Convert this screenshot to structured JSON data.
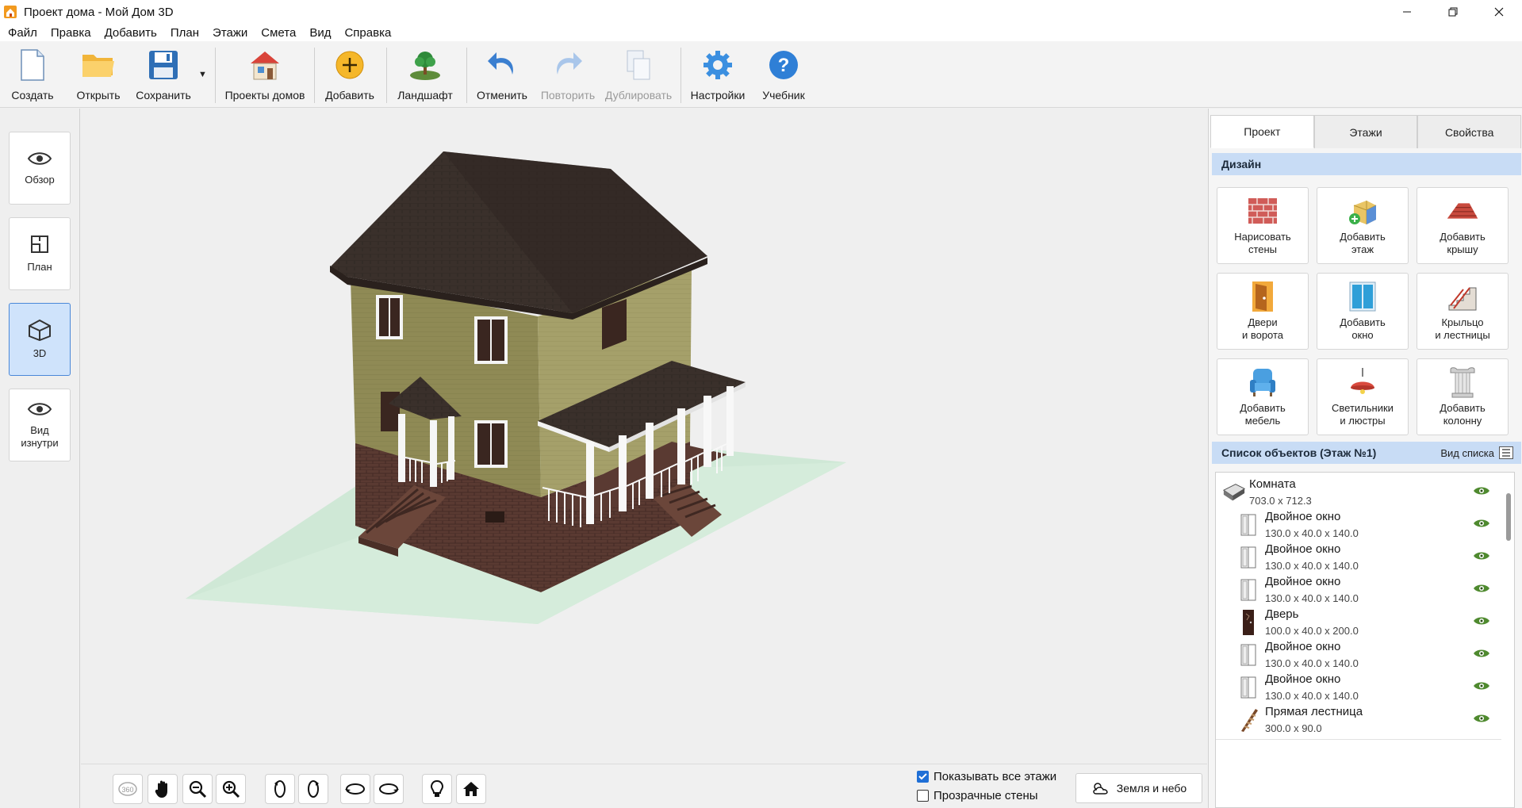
{
  "window": {
    "title": "Проект дома - Мой Дом 3D"
  },
  "menu": [
    "Файл",
    "Правка",
    "Добавить",
    "План",
    "Этажи",
    "Смета",
    "Вид",
    "Справка"
  ],
  "toolbar": {
    "create": "Создать",
    "open": "Открыть",
    "save": "Сохранить",
    "projects": "Проекты домов",
    "add": "Добавить",
    "landscape": "Ландшафт",
    "undo": "Отменить",
    "redo": "Повторить",
    "duplicate": "Дублировать",
    "settings": "Настройки",
    "tutorial": "Учебник"
  },
  "left_nav": {
    "overview": "Обзор",
    "plan": "План",
    "view3d": "3D",
    "inside_line1": "Вид",
    "inside_line2": "изнутри",
    "active": "3D"
  },
  "bottom": {
    "show_all_floors": "Показывать все этажи",
    "show_all_floors_checked": true,
    "transparent_walls": "Прозрачные стены",
    "transparent_walls_checked": false,
    "earth_sky": "Земля и небо",
    "rotate360_label": "360"
  },
  "right_panel": {
    "tabs": [
      "Проект",
      "Этажи",
      "Свойства"
    ],
    "active_tab": "Проект",
    "design_title": "Дизайн",
    "design_buttons": [
      {
        "l1": "Нарисовать",
        "l2": "стены",
        "icon": "brick-wall-icon"
      },
      {
        "l1": "Добавить",
        "l2": "этаж",
        "icon": "add-floor-icon"
      },
      {
        "l1": "Добавить",
        "l2": "крышу",
        "icon": "roof-icon"
      },
      {
        "l1": "Двери",
        "l2": "и ворота",
        "icon": "door-icon"
      },
      {
        "l1": "Добавить",
        "l2": "окно",
        "icon": "window-icon"
      },
      {
        "l1": "Крыльцо",
        "l2": "и лестницы",
        "icon": "stairs-icon"
      },
      {
        "l1": "Добавить",
        "l2": "мебель",
        "icon": "armchair-icon"
      },
      {
        "l1": "Светильники",
        "l2": "и люстры",
        "icon": "chandelier-icon"
      },
      {
        "l1": "Добавить",
        "l2": "колонну",
        "icon": "column-icon"
      }
    ],
    "objects_title": "Список объектов (Этаж №1)",
    "list_view": "Вид списка",
    "objects": [
      {
        "name": "Комната",
        "dims": "703.0 x 712.3",
        "icon": "room-icon"
      },
      {
        "name": "Двойное окно",
        "dims": "130.0 x 40.0 x 140.0",
        "icon": "window-icon"
      },
      {
        "name": "Двойное окно",
        "dims": "130.0 x 40.0 x 140.0",
        "icon": "window-icon"
      },
      {
        "name": "Двойное окно",
        "dims": "130.0 x 40.0 x 140.0",
        "icon": "window-icon"
      },
      {
        "name": "Дверь",
        "dims": "100.0 x 40.0 x 200.0",
        "icon": "door-icon"
      },
      {
        "name": "Двойное окно",
        "dims": "130.0 x 40.0 x 140.0",
        "icon": "window-icon"
      },
      {
        "name": "Двойное окно",
        "dims": "130.0 x 40.0 x 140.0",
        "icon": "window-icon"
      },
      {
        "name": "Прямая лестница",
        "dims": "300.0 x 90.0",
        "icon": "stairs-icon"
      }
    ]
  },
  "colors": {
    "accent": "#1f6fd6",
    "section_header": "#c8dcf5",
    "roof": "#3a302b",
    "wall": "#8f8a55",
    "brick": "#5a3a32",
    "ground": "#cfe8d6"
  }
}
